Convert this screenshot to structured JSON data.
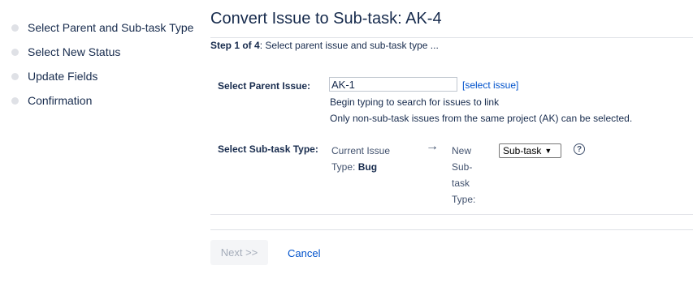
{
  "sidebar": {
    "steps": [
      {
        "label": "Select Parent and Sub-task Type"
      },
      {
        "label": "Select New Status"
      },
      {
        "label": "Update Fields"
      },
      {
        "label": "Confirmation"
      }
    ]
  },
  "main": {
    "title": "Convert Issue to Sub-task: AK-4",
    "step_prefix": "Step 1 of 4",
    "step_text": ": Select parent issue and sub-task type ...",
    "parent_issue": {
      "label": "Select Parent Issue:",
      "value": "AK-1",
      "link": "[select issue]",
      "help1": "Begin typing to search for issues to link",
      "help2": "Only non-sub-task issues from the same project (AK) can be selected."
    },
    "subtask_type": {
      "label": "Select Sub-task Type:",
      "current_prefix": "Current Issue Type:",
      "current_value": "Bug",
      "arrow": "→",
      "new_label": "New Sub-task Type:",
      "selected": "Sub-task",
      "help_icon": "?"
    },
    "buttons": {
      "next": "Next >>",
      "cancel": "Cancel"
    }
  }
}
